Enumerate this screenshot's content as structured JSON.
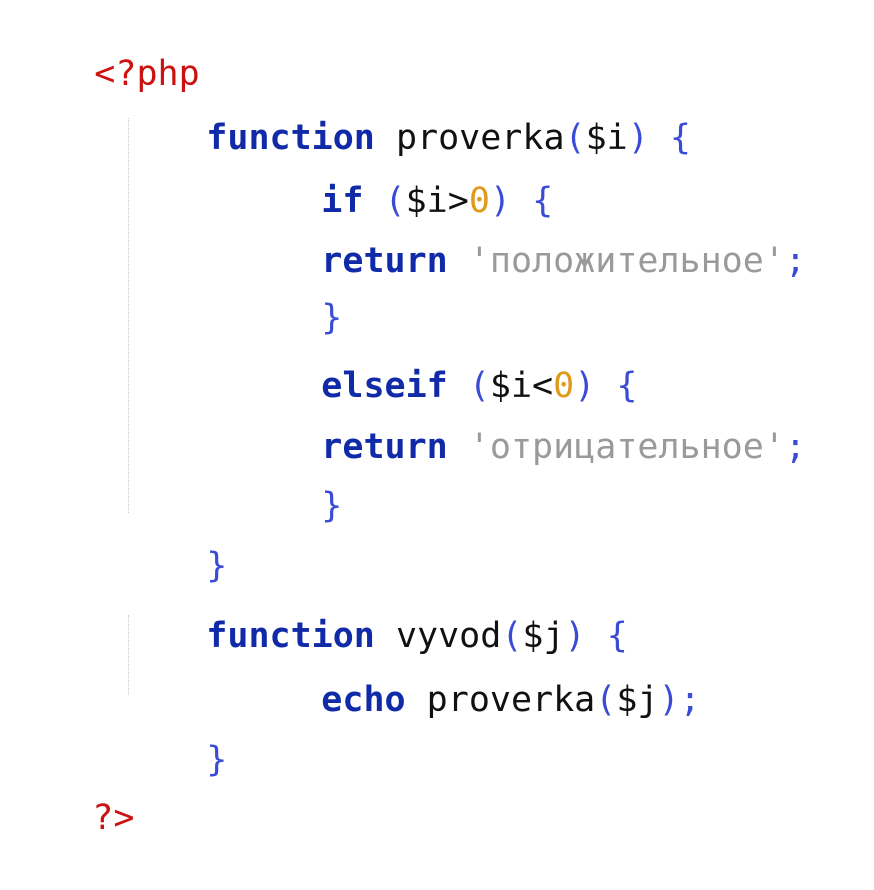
{
  "code": {
    "open_tag": "<?php",
    "close_tag": "?>",
    "func1": {
      "keyword": "function",
      "name": "proverka",
      "open_paren": "(",
      "param": "$i",
      "close_paren_brace": ") {"
    },
    "if_line": {
      "keyword": "if",
      "open": "(",
      "var": "$i",
      "op": ">",
      "number": "0",
      "close": ") {"
    },
    "return1": {
      "keyword": "return",
      "string": "'положительное'",
      "semicolon": ";"
    },
    "brace_if_close": "}",
    "elseif_line": {
      "keyword": "elseif",
      "open": "(",
      "var": "$i",
      "op": "<",
      "number": "0",
      "close": ") {"
    },
    "return2": {
      "keyword": "return",
      "string": "'отрицательное'",
      "semicolon": ";"
    },
    "brace_elseif_close": "}",
    "brace_func1_close": "}",
    "func2": {
      "keyword": "function",
      "name": "vyvod",
      "open_paren": "(",
      "param": "$j",
      "close_paren_brace": ") {"
    },
    "echo_line": {
      "keyword": "echo",
      "call": "proverka",
      "open": "(",
      "arg": "$j",
      "close": ");"
    },
    "brace_func2_close": "}"
  }
}
